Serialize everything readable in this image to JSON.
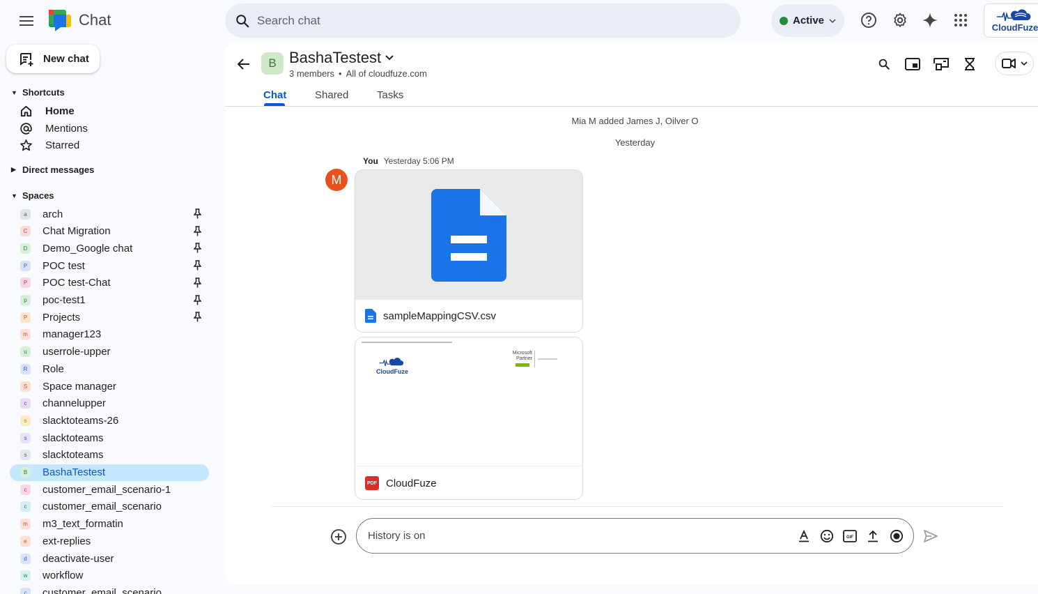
{
  "app": {
    "name": "Chat"
  },
  "search": {
    "placeholder": "Search chat"
  },
  "status": {
    "label": "Active",
    "color": "#1e8e3e"
  },
  "brand": {
    "label": "CloudFuze"
  },
  "sidebar": {
    "new_chat": "New chat",
    "shortcuts_label": "Shortcuts",
    "shortcuts": [
      {
        "label": "Home",
        "icon": "home-icon"
      },
      {
        "label": "Mentions",
        "icon": "at-icon"
      },
      {
        "label": "Starred",
        "icon": "star-icon"
      }
    ],
    "direct_messages_label": "Direct messages",
    "spaces_label": "Spaces",
    "spaces": [
      {
        "label": "arch",
        "initial": "a",
        "pinned": true,
        "bg": "#dfe3eb",
        "fg": "#5a6372"
      },
      {
        "label": "Chat Migration",
        "initial": "C",
        "pinned": true,
        "bg": "#f9dcd8",
        "fg": "#b0473b"
      },
      {
        "label": "Demo_Google chat",
        "initial": "D",
        "pinned": true,
        "bg": "#d6efd8",
        "fg": "#2e7d32"
      },
      {
        "label": "POC test",
        "initial": "P",
        "pinned": true,
        "bg": "#d8e3fb",
        "fg": "#3b5cc4"
      },
      {
        "label": "POC test-Chat",
        "initial": "P",
        "pinned": true,
        "bg": "#f8d6e6",
        "fg": "#b03a74"
      },
      {
        "label": "poc-test1",
        "initial": "p",
        "pinned": true,
        "bg": "#d6efd8",
        "fg": "#2e7d32"
      },
      {
        "label": "Projects",
        "initial": "P",
        "pinned": true,
        "bg": "#fbe3cc",
        "fg": "#b7621d"
      },
      {
        "label": "manager123",
        "initial": "m",
        "pinned": false,
        "bg": "#fbe0d3",
        "fg": "#b85a2d"
      },
      {
        "label": "userrole-upper",
        "initial": "u",
        "pinned": false,
        "bg": "#d6efd8",
        "fg": "#2e7d32"
      },
      {
        "label": "Role",
        "initial": "R",
        "pinned": false,
        "bg": "#d8e3fb",
        "fg": "#3b5cc4"
      },
      {
        "label": "Space manager",
        "initial": "S",
        "pinned": false,
        "bg": "#fbe0d3",
        "fg": "#b85a2d"
      },
      {
        "label": "channelupper",
        "initial": "c",
        "pinned": false,
        "bg": "#ead9f7",
        "fg": "#7c3fb3"
      },
      {
        "label": "slacktoteams-26",
        "initial": "s",
        "pinned": false,
        "bg": "#fbecc6",
        "fg": "#a77b12"
      },
      {
        "label": "slacktoteams",
        "initial": "s",
        "pinned": false,
        "bg": "#e6e1f7",
        "fg": "#5b4db3"
      },
      {
        "label": "slacktoteams",
        "initial": "s",
        "pinned": false,
        "bg": "#e3e6ee",
        "fg": "#5a6372"
      },
      {
        "label": "BashaTestest",
        "initial": "B",
        "pinned": false,
        "bg": "#d6efd8",
        "fg": "#2e7d32",
        "selected": true
      },
      {
        "label": "customer_email_scenario-1",
        "initial": "c",
        "pinned": false,
        "bg": "#f8d6e6",
        "fg": "#b03a74"
      },
      {
        "label": "customer_email_scenario",
        "initial": "c",
        "pinned": false,
        "bg": "#d8ecf7",
        "fg": "#2c6f9c"
      },
      {
        "label": "m3_text_formatin",
        "initial": "m",
        "pinned": false,
        "bg": "#fbe0d3",
        "fg": "#b85a2d"
      },
      {
        "label": "ext-replies",
        "initial": "e",
        "pinned": false,
        "bg": "#fbe0d3",
        "fg": "#b85a2d"
      },
      {
        "label": "deactivate-user",
        "initial": "d",
        "pinned": false,
        "bg": "#d8e3fb",
        "fg": "#3b5cc4"
      },
      {
        "label": "workflow",
        "initial": "w",
        "pinned": false,
        "bg": "#d6f1ee",
        "fg": "#1f7a6d"
      },
      {
        "label": "customer_email_scenario",
        "initial": "c",
        "pinned": false,
        "bg": "#d8e3fb",
        "fg": "#3b5cc4"
      }
    ]
  },
  "space": {
    "initial": "B",
    "title": "BashaTestest",
    "members": "3 members",
    "separator": "•",
    "domain": "All of cloudfuze.com",
    "tabs": [
      "Chat",
      "Shared",
      "Tasks"
    ]
  },
  "messages": {
    "system": "Mia M added James J, Oilver O",
    "date": "Yesterday",
    "author_initial": "M",
    "author": "You",
    "time": "Yesterday 5:06 PM",
    "attachments": [
      {
        "name": "sampleMappingCSV.csv",
        "type": "doc"
      },
      {
        "name": "CloudFuze",
        "type": "pdf",
        "preview_logo": "CloudFuze",
        "preview_partner": "Microsoft Partner",
        "badge": "PDF"
      }
    ]
  },
  "compose": {
    "placeholder": "History is on"
  },
  "colors": {
    "accent": "#0b57d0",
    "selected_bg": "#c2e7ff",
    "doc_blue": "#1a73e8",
    "pdf_red": "#d93025"
  }
}
